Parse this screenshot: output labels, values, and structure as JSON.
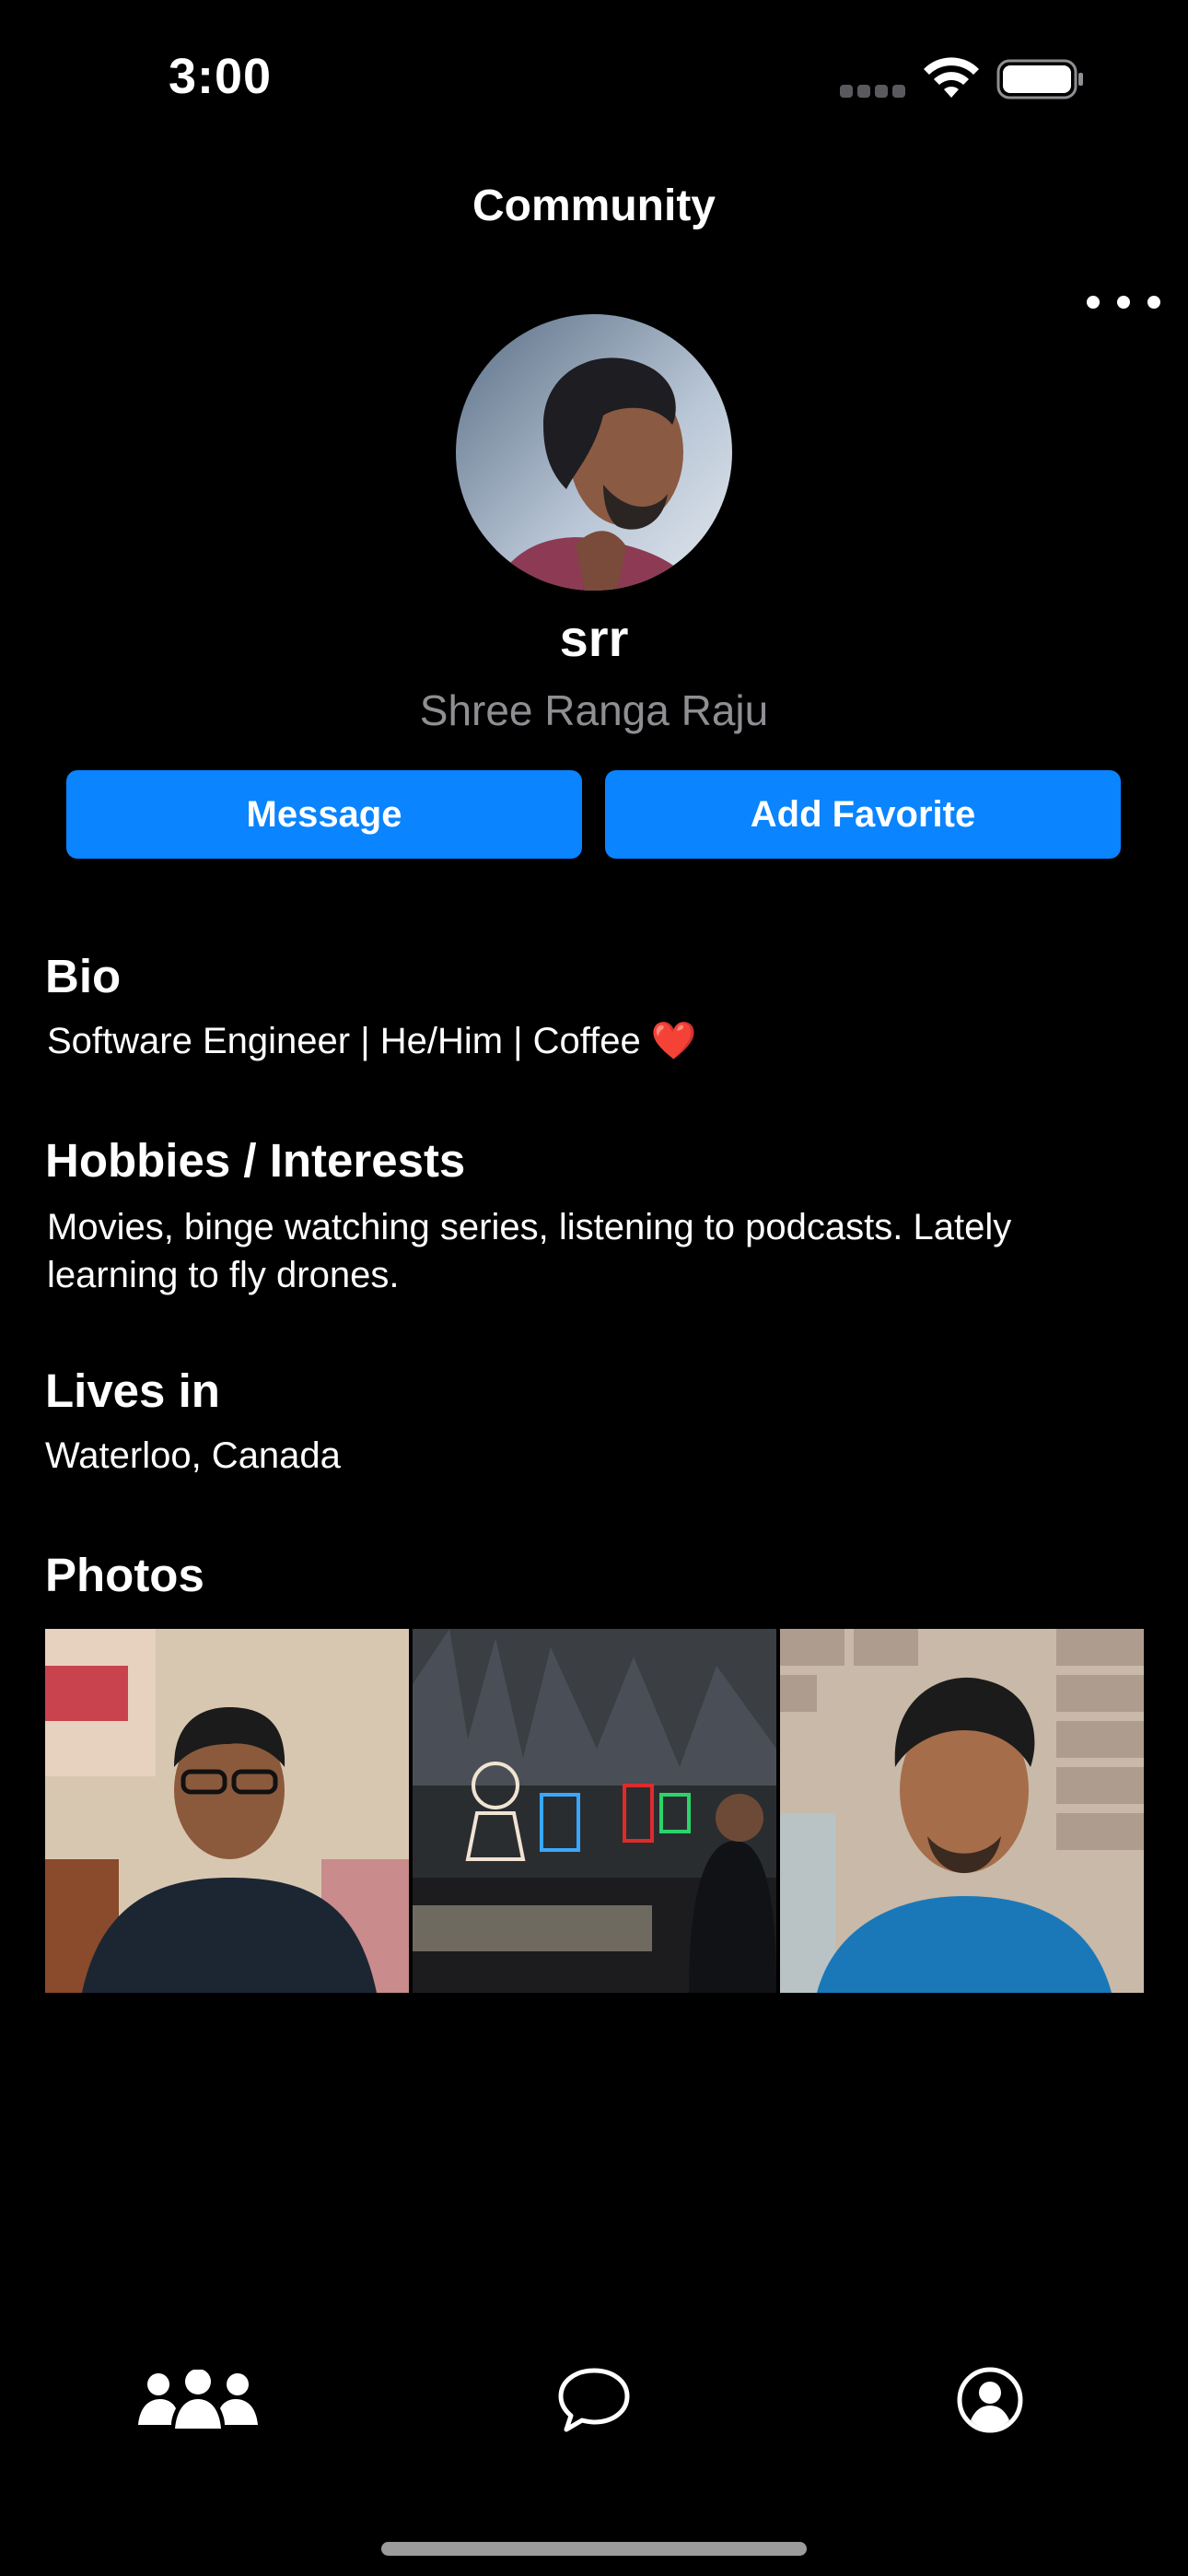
{
  "status_bar": {
    "time": "3:00"
  },
  "nav": {
    "title": "Community",
    "more_icon": "ellipsis-icon"
  },
  "profile": {
    "username": "srr",
    "full_name": "Shree Ranga Raju"
  },
  "actions": {
    "message_label": "Message",
    "favorite_label": "Add Favorite"
  },
  "bio": {
    "title": "Bio",
    "text": "Software Engineer | He/Him | Coffee ",
    "emoji": "❤️"
  },
  "hobbies": {
    "title": "Hobbies / Interests",
    "text": "Movies, binge watching series, listening to podcasts. Lately learning to fly drones."
  },
  "location": {
    "title": "Lives in",
    "text": "Waterloo, Canada"
  },
  "photos": {
    "title": "Photos"
  },
  "tab_bar": {
    "items": [
      {
        "icon": "people-icon"
      },
      {
        "icon": "chat-bubble-icon"
      },
      {
        "icon": "profile-circle-icon"
      }
    ]
  },
  "colors": {
    "accent": "#0a84ff",
    "background": "#000000",
    "secondary_text": "#8e8e93"
  }
}
